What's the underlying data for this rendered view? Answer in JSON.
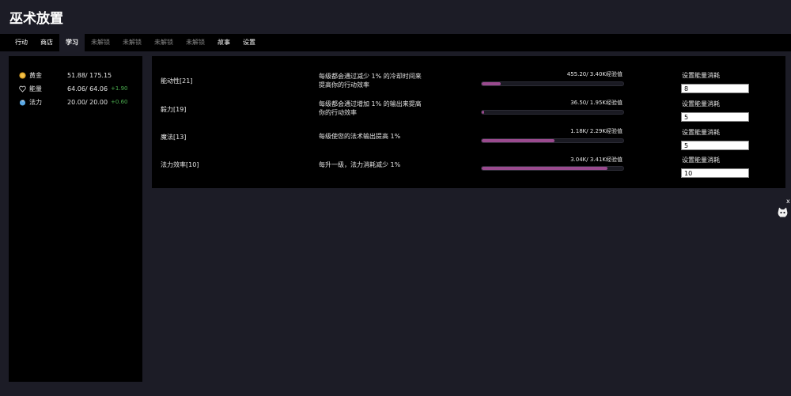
{
  "app": {
    "title": "巫术放置"
  },
  "tabs": [
    {
      "label": "行动"
    },
    {
      "label": "商店"
    },
    {
      "label": "学习"
    },
    {
      "label": "未解锁"
    },
    {
      "label": "未解锁"
    },
    {
      "label": "未解锁"
    },
    {
      "label": "未解锁"
    },
    {
      "label": "故事"
    },
    {
      "label": "设置"
    }
  ],
  "resources": [
    {
      "icon": "gold-coin-icon",
      "name": "黄金",
      "value": "51.88/ 175.15",
      "rate": ""
    },
    {
      "icon": "energy-heart-icon",
      "name": "能量",
      "value": "64.06/ 64.06",
      "rate": "+1.90"
    },
    {
      "icon": "mana-orb-icon",
      "name": "法力",
      "value": "20.00/ 20.00",
      "rate": "+0.60"
    }
  ],
  "skills": [
    {
      "name": "能动性[21]",
      "desc": "每级都会通过减少 1% 的冷却时间来提高你的行动效率",
      "xp": "455.20/ 3.40K经验值",
      "progress": 0.134,
      "label": "设置能量消耗",
      "input": "8"
    },
    {
      "name": "毅力[19]",
      "desc": "每级都会通过增加 1% 的输出来提高你的行动效率",
      "xp": "36.50/ 1.95K经验值",
      "progress": 0.019,
      "label": "设置能量消耗",
      "input": "5"
    },
    {
      "name": "魔法[13]",
      "desc": "每级使您的法术输出提高 1%",
      "xp": "1.18K/ 2.29K经验值",
      "progress": 0.515,
      "label": "设置能量消耗",
      "input": "5"
    },
    {
      "name": "法力效率[10]",
      "desc": "每升一级，法力消耗减少 1%",
      "xp": "3.04K/ 3.41K经验值",
      "progress": 0.891,
      "label": "设置能量消耗",
      "input": "10"
    }
  ],
  "widget": {
    "close": "x"
  },
  "colors": {
    "bg": "#1c1c26",
    "panel": "#000000",
    "accent": "#9a4a8e",
    "rate": "#4caf50"
  }
}
